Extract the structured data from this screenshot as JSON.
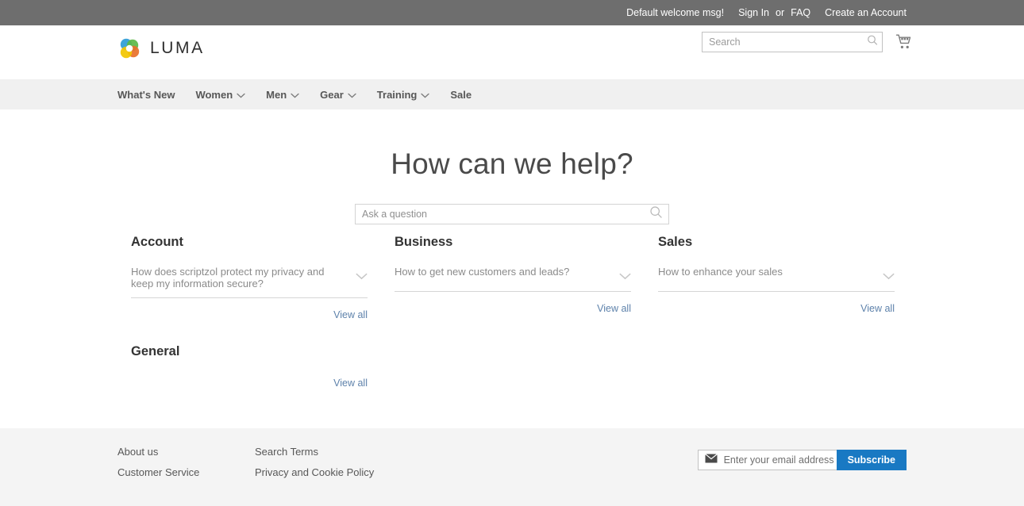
{
  "top_panel": {
    "welcome": "Default welcome msg!",
    "sign_in": "Sign In",
    "separator": "or",
    "faq": "FAQ",
    "create_account": "Create an Account"
  },
  "header": {
    "logo_text": "LUMA",
    "logo_icon": "luma-flower-icon",
    "search_placeholder": "Search",
    "search_value": "",
    "search_icon": "search-icon",
    "cart_icon": "shopping-cart-icon"
  },
  "nav": {
    "items": [
      {
        "label": "What's New",
        "has_caret": false
      },
      {
        "label": "Women",
        "has_caret": true
      },
      {
        "label": "Men",
        "has_caret": true
      },
      {
        "label": "Gear",
        "has_caret": true
      },
      {
        "label": "Training",
        "has_caret": true
      },
      {
        "label": "Sale",
        "has_caret": false
      }
    ]
  },
  "main": {
    "title": "How can we help?",
    "ask_placeholder": "Ask a question",
    "ask_value": "",
    "ask_icon": "search-icon",
    "view_all_label": "View all",
    "categories": [
      {
        "name": "Account",
        "questions": [
          "How does scriptzol protect my privacy and keep my information secure?"
        ]
      },
      {
        "name": "Business",
        "questions": [
          "How to get new customers and leads?"
        ]
      },
      {
        "name": "Sales",
        "questions": [
          "How to enhance your sales"
        ]
      },
      {
        "name": "General",
        "questions": []
      }
    ]
  },
  "footer": {
    "links_col1": [
      "About us",
      "Customer Service"
    ],
    "links_col2": [
      "Search Terms",
      "Privacy and Cookie Policy"
    ],
    "newsletter": {
      "placeholder": "Enter your email address",
      "value": "",
      "icon": "envelope-icon",
      "button_label": "Subscribe"
    }
  },
  "colors": {
    "top_bar": "#6e6e6e",
    "nav_bar": "#f0f0f0",
    "footer_bg": "#f4f4f4",
    "link_blue": "#5e82ab",
    "button_blue": "#1979c3",
    "heading": "#333333"
  }
}
